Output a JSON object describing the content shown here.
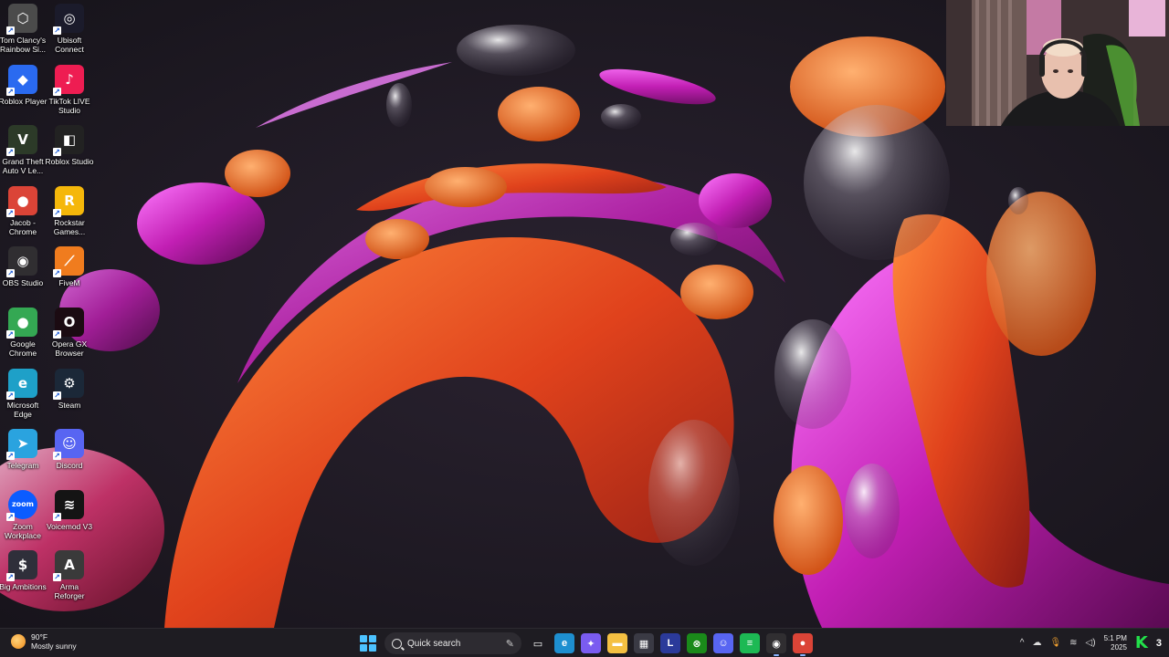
{
  "desktop": {
    "icons": [
      {
        "label": "Tom Clancy's Rainbow Si...",
        "icon": "rainbow-six-icon",
        "glyph": "⬡",
        "bg": "#4b4b4b"
      },
      {
        "label": "Ubisoft Connect",
        "icon": "ubisoft-icon",
        "glyph": "◎",
        "bg": "#1b1b2b"
      },
      {
        "label": "Roblox Player",
        "icon": "roblox-player-icon",
        "glyph": "◆",
        "bg": "#2a6af0"
      },
      {
        "label": "TikTok LIVE Studio",
        "icon": "tiktok-icon",
        "glyph": "♪",
        "bg": "#ee1d52"
      },
      {
        "label": "Grand Theft Auto V Le...",
        "icon": "gta-icon",
        "glyph": "V",
        "bg": "#2c3a28"
      },
      {
        "label": "Roblox Studio",
        "icon": "roblox-studio-icon",
        "glyph": "◧",
        "bg": "#222222"
      },
      {
        "label": "Jacob - Chrome",
        "icon": "chrome-profile-icon",
        "glyph": "●",
        "bg": "#db4437"
      },
      {
        "label": "Rockstar Games...",
        "icon": "rockstar-icon",
        "glyph": "R",
        "bg": "#f5b70a"
      },
      {
        "label": "OBS Studio",
        "icon": "obs-icon",
        "glyph": "◉",
        "bg": "#302e31"
      },
      {
        "label": "FiveM",
        "icon": "fivem-icon",
        "glyph": "⟋",
        "bg": "#f07c1e"
      },
      {
        "label": "Google Chrome",
        "icon": "chrome-icon",
        "glyph": "●",
        "bg": "#34a853"
      },
      {
        "label": "Opera GX Browser",
        "icon": "opera-gx-icon",
        "glyph": "O",
        "bg": "#1b0b12"
      },
      {
        "label": "Microsoft Edge",
        "icon": "edge-icon",
        "glyph": "e",
        "bg": "#1ea0c8"
      },
      {
        "label": "Steam",
        "icon": "steam-icon",
        "glyph": "⚙",
        "bg": "#1b2838"
      },
      {
        "label": "Telegram",
        "icon": "telegram-icon",
        "glyph": "➤",
        "bg": "#2aa3df"
      },
      {
        "label": "Discord",
        "icon": "discord-icon",
        "glyph": "☺",
        "bg": "#5865f2"
      },
      {
        "label": "Zoom Workplace",
        "icon": "zoom-icon",
        "glyph": "zoom",
        "bg": "#0b5cff"
      },
      {
        "label": "Voicemod V3",
        "icon": "voicemod-icon",
        "glyph": "≋",
        "bg": "#141414"
      },
      {
        "label": "Big Ambitions",
        "icon": "big-ambitions-icon",
        "glyph": "$",
        "bg": "#2f2f3a"
      },
      {
        "label": "Arma Reforger",
        "icon": "arma-reforger-icon",
        "glyph": "A",
        "bg": "#3a3a3a"
      }
    ]
  },
  "webcam": {
    "label": "webcam-overlay"
  },
  "taskbar": {
    "weather": {
      "temp": "90°F",
      "condition": "Mostly sunny"
    },
    "search": {
      "placeholder": "Quick search"
    },
    "apps": [
      {
        "name": "task-view",
        "glyph": "▭",
        "bg": "transparent"
      },
      {
        "name": "edge",
        "glyph": "e",
        "bg": "#1e8fd0"
      },
      {
        "name": "copilot",
        "glyph": "✦",
        "bg": "#7a5cf0"
      },
      {
        "name": "file-explorer",
        "glyph": "▬",
        "bg": "#f4c042"
      },
      {
        "name": "microsoft-store",
        "glyph": "▦",
        "bg": "#3a3a44"
      },
      {
        "name": "launcher-l",
        "glyph": "L",
        "bg": "#2b3a9a"
      },
      {
        "name": "xbox",
        "glyph": "⊗",
        "bg": "#1a8a1a"
      },
      {
        "name": "discord",
        "glyph": "☺",
        "bg": "#5865f2"
      },
      {
        "name": "spotify",
        "glyph": "≡",
        "bg": "#1db954"
      },
      {
        "name": "obs",
        "glyph": "◉",
        "bg": "#302e31"
      },
      {
        "name": "chrome",
        "glyph": "●",
        "bg": "#db4437"
      }
    ],
    "tray": {
      "chevron": "^",
      "clock_time": "5:1 PM",
      "clock_date": "2025",
      "badge": "3"
    }
  }
}
